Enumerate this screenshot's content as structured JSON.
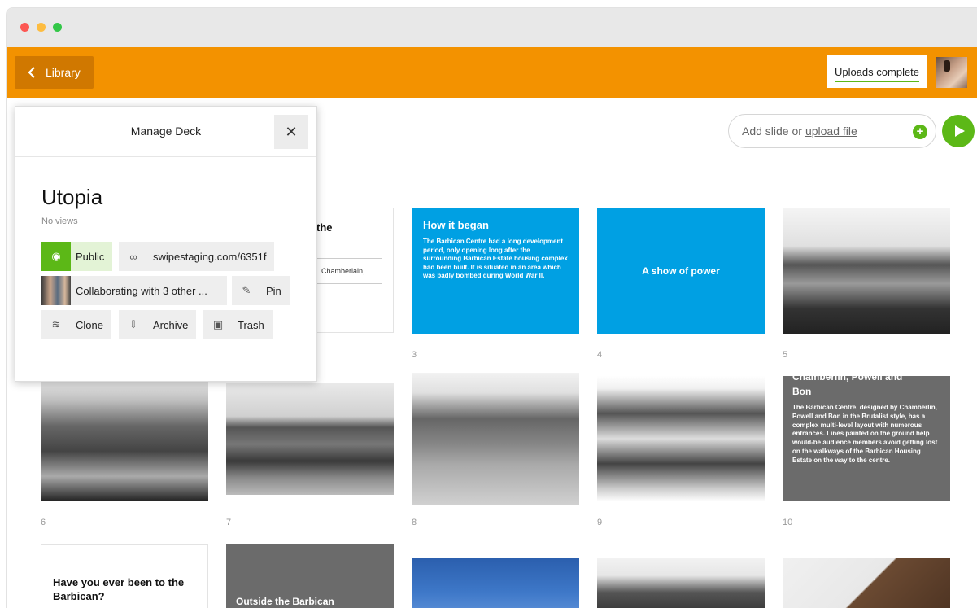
{
  "topbar": {
    "back_label": "Library",
    "uploads_label": "Uploads complete"
  },
  "toolbar": {
    "add_slide_prefix": "Add slide or",
    "upload_link": "upload file"
  },
  "panel": {
    "title": "Manage Deck",
    "deck_title": "Utopia",
    "views": "No views",
    "public_label": "Public",
    "share_url": "swipestaging.com/6351f",
    "collab_label": "Collaborating with 3 other ...",
    "pin_label": "Pin",
    "clone_label": "Clone",
    "archive_label": "Archive",
    "trash_label": "Trash"
  },
  "slides": {
    "partial_slide": {
      "title_fragment": "the",
      "chip": "Chamberlain,..."
    },
    "s3": {
      "number": "3",
      "title": "How it began",
      "body": "The Barbican Centre had a long development period, only opening long after the surrounding Barbican Estate housing complex had been built. It is situated in an area which was badly bombed during World War II."
    },
    "s4": {
      "number": "4",
      "title": "A show of power"
    },
    "s5": {
      "number": "5"
    },
    "s6": {
      "number": "6"
    },
    "s7": {
      "number": "7"
    },
    "s8": {
      "number": "8"
    },
    "s9": {
      "number": "9"
    },
    "s10": {
      "number": "10",
      "title_top": "Chamberlin, Powell and",
      "title": "Bon",
      "body": "The Barbican Centre, designed by Chamberlin, Powell and Bon in the Brutalist style, has a complex multi-level layout with numerous entrances. Lines painted on the ground help would-be audience members avoid getting lost on the walkways of the Barbican Housing Estate on the way to the centre."
    },
    "s11": {
      "title": "Have you ever been to the Barbican?"
    },
    "s12": {
      "title": "Outside the Barbican"
    }
  },
  "colors": {
    "brand_orange": "#f39200",
    "accent_green": "#5cb817",
    "slide_blue": "#00a0e3",
    "slide_gray": "#6b6b6b"
  }
}
